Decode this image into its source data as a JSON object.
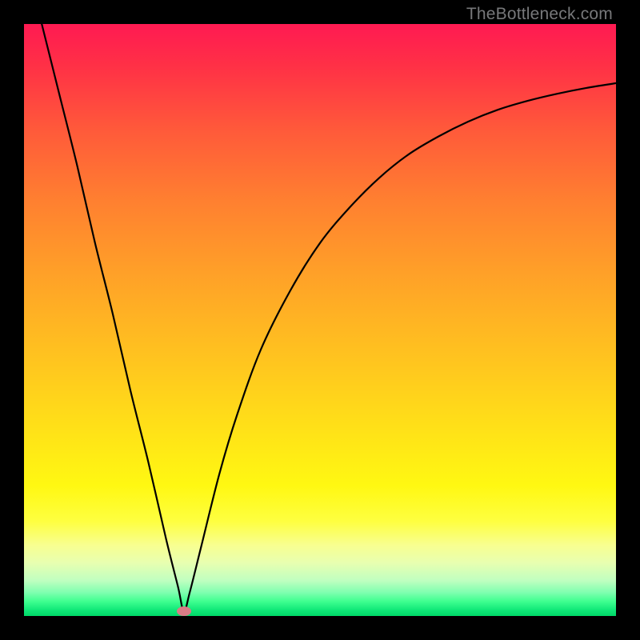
{
  "watermark": "TheBottleneck.com",
  "chart_data": {
    "type": "line",
    "title": "",
    "xlabel": "",
    "ylabel": "",
    "xlim": [
      0,
      100
    ],
    "ylim": [
      0,
      100
    ],
    "minimum_marker": {
      "x": 27,
      "y": 0.8
    },
    "series": [
      {
        "name": "curve",
        "x": [
          3,
          6,
          9,
          12,
          15,
          18,
          21,
          24,
          26,
          27,
          28,
          30,
          33,
          36,
          40,
          45,
          50,
          55,
          60,
          65,
          70,
          75,
          80,
          85,
          90,
          95,
          100
        ],
        "y": [
          100,
          88,
          76,
          63,
          51,
          38,
          26,
          13,
          5,
          0.8,
          4,
          12,
          24,
          34,
          45,
          55,
          63,
          69,
          74,
          78,
          81,
          83.5,
          85.5,
          87,
          88.2,
          89.2,
          90
        ]
      }
    ],
    "gradient_stops": [
      {
        "pos": 0,
        "color": "#ff1a52"
      },
      {
        "pos": 50,
        "color": "#ffc020"
      },
      {
        "pos": 85,
        "color": "#feff40"
      },
      {
        "pos": 100,
        "color": "#00d868"
      }
    ]
  }
}
